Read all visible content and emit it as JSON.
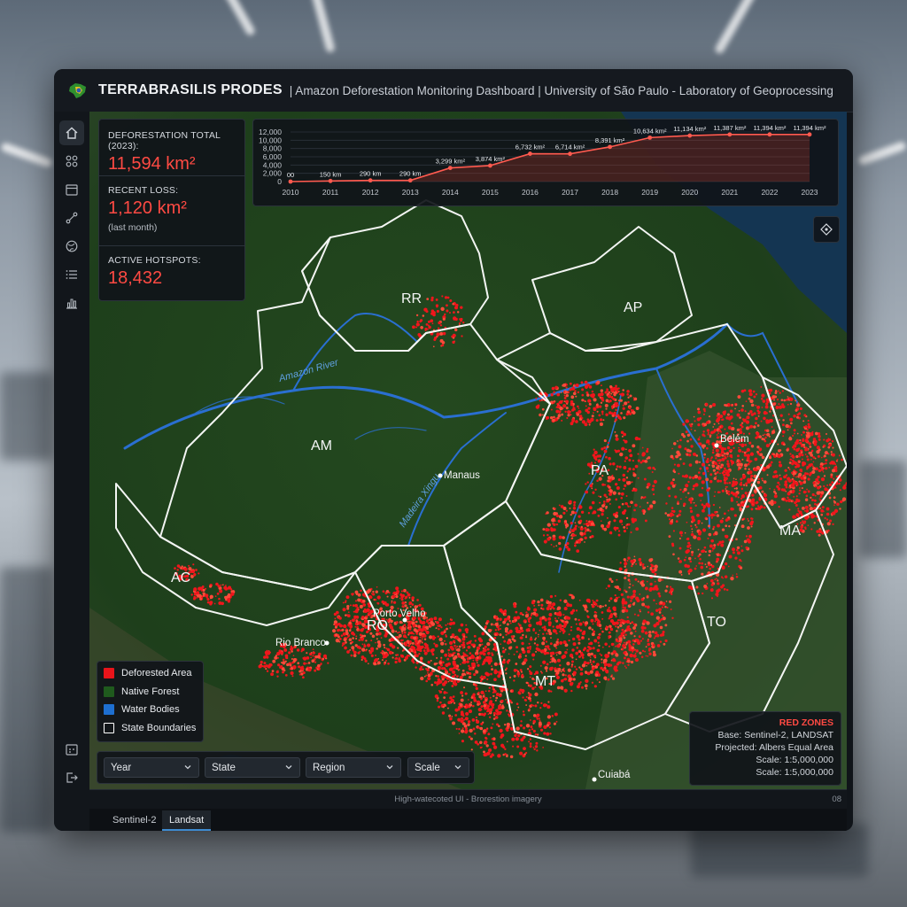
{
  "window": {
    "title": "TERRABRASILIS PRODES",
    "subtitle": "| Amazon Deforestation Monitoring Dashboard | University of São Paulo - Laboratory of Geoprocessing"
  },
  "sidebar": {
    "items": [
      {
        "icon": "home-icon",
        "active": true
      },
      {
        "icon": "layers-icon"
      },
      {
        "icon": "calendar-icon"
      },
      {
        "icon": "route-icon"
      },
      {
        "icon": "globe-icon"
      },
      {
        "icon": "list-icon"
      },
      {
        "icon": "bar-chart-icon"
      }
    ],
    "bottom_items": [
      {
        "icon": "schedule-icon"
      },
      {
        "icon": "logout-icon"
      }
    ]
  },
  "stats": {
    "total_label": "DEFORESTATION TOTAL (2023):",
    "total_value": "11,594 km²",
    "recent_label": "RECENT LOSS:",
    "recent_value": "1,120 km²",
    "recent_note": "(last month)",
    "hotspots_label": "ACTIVE HOTSPOTS:",
    "hotspots_value": "18,432"
  },
  "chart_data": {
    "type": "line",
    "x": [
      "2010",
      "2011",
      "2012",
      "2013",
      "2014",
      "2015",
      "2016",
      "2017",
      "2018",
      "2019",
      "2020",
      "2021",
      "2022",
      "2023"
    ],
    "values": [
      0,
      150,
      290,
      290,
      3299,
      3874,
      6732,
      6714,
      8391,
      10634,
      11134,
      11387,
      11394,
      11394
    ],
    "point_labels": [
      "00",
      "150 km",
      "290 km",
      "290 km",
      "3,299 km²",
      "3,874 km²",
      "6,732 km²",
      "6,714 km²",
      "8,391 km²",
      "10,634 km²",
      "11,134 km²",
      "11,387 km²",
      "11,394 km²",
      "11,394 km²"
    ],
    "yticks": [
      "0",
      "2,000",
      "4,000",
      "6,000",
      "8,000",
      "10,000",
      "12,000"
    ],
    "ylim": [
      0,
      12000
    ],
    "color": "#ff5a4f",
    "grid": true
  },
  "map": {
    "states": [
      "RR",
      "AP",
      "AM",
      "PA",
      "MA",
      "AC",
      "RO",
      "MT",
      "TO"
    ],
    "cities": [
      "Manaus",
      "Belém",
      "Porto Velho",
      "Rio Branco",
      "Cuiabá"
    ],
    "rivers": [
      "Amazon River",
      "Madeira Xingu"
    ]
  },
  "legend": {
    "items": [
      {
        "label": "Deforested Area",
        "color": "#e8141a"
      },
      {
        "label": "Native Forest",
        "color": "#1f5a1d"
      },
      {
        "label": "Water Bodies",
        "color": "#1e6fd0"
      },
      {
        "label": "State Boundaries",
        "color": "#ffffff"
      }
    ]
  },
  "info": {
    "title": "RED ZONES",
    "base": "Base: Sentinel-2, LANDSAT",
    "projection": "Projected: Albers Equal Area",
    "scale1": "Scale: 1:5,000,000",
    "scale2": "Scale: 1:5,000,000"
  },
  "filters": {
    "year": "Year",
    "state": "State",
    "region": "Region",
    "scale": "Scale"
  },
  "footer": {
    "text": "High-watecoted UI - Brorestion imagery",
    "right": "08"
  },
  "tabs": [
    {
      "label": "Sentinel-2"
    },
    {
      "label": "Landsat",
      "active": true
    }
  ]
}
